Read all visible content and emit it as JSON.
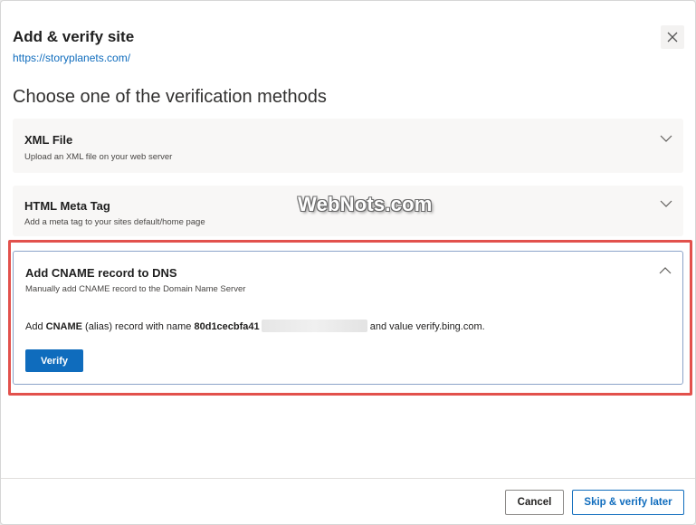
{
  "dialog": {
    "title": "Add & verify site",
    "site_url": "https://storyplanets.com/",
    "heading": "Choose one of the verification methods"
  },
  "methods": [
    {
      "title": "XML File",
      "description": "Upload an XML file on your web server",
      "expanded": false
    },
    {
      "title": "HTML Meta Tag",
      "description": "Add a meta tag to your sites default/home page",
      "expanded": false
    },
    {
      "title": "Add CNAME record to DNS",
      "description": "Manually add CNAME record to the Domain Name Server",
      "expanded": true
    }
  ],
  "cname": {
    "text_add": "Add",
    "record_type": "CNAME",
    "text_alias": "(alias) record with name",
    "record_name_visible": "80d1cecbfa41",
    "text_value": "and value verify.bing.com.",
    "verify_label": "Verify"
  },
  "watermark": "WebNots.com",
  "footer": {
    "cancel_label": "Cancel",
    "skip_label": "Skip & verify later"
  },
  "colors": {
    "accent": "#0f6cbd",
    "highlight": "#e2514c"
  }
}
